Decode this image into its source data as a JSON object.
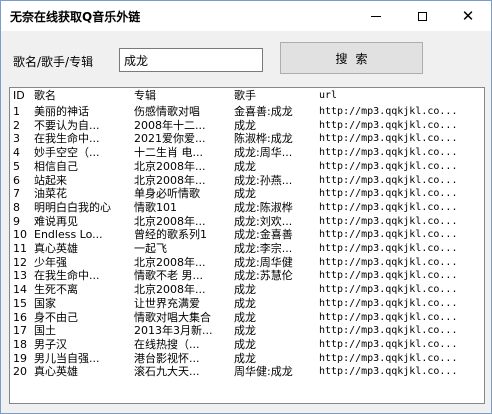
{
  "window": {
    "title": "无奈在线获取Q音乐外链",
    "min_label": "—",
    "max_label": "□",
    "close_label": "✕"
  },
  "search": {
    "label": "歌名/歌手/专辑",
    "value": "成龙",
    "button_label": "搜索"
  },
  "table": {
    "columns": [
      "ID",
      "歌名",
      "专辑",
      "歌手",
      "url"
    ],
    "rows": [
      [
        "1",
        "美丽的神话",
        "伤感情歌对唱",
        "金喜善:成龙",
        "http://mp3.qqkjkl.co..."
      ],
      [
        "2",
        "不要认为自...",
        "2008年十二...",
        "成龙",
        "http://mp3.qqkjkl.co..."
      ],
      [
        "3",
        "在我生命中...",
        "2021爱你爱...",
        "陈淑桦:成龙",
        "http://mp3.qqkjkl.co..."
      ],
      [
        "4",
        "妙手空空（...",
        "十二生肖 电...",
        "成龙:周华...",
        "http://mp3.qqkjkl.co..."
      ],
      [
        "5",
        "相信自己",
        "北京2008年...",
        "成龙",
        "http://mp3.qqkjkl.co..."
      ],
      [
        "6",
        "站起来",
        "北京2008年...",
        "成龙:孙燕...",
        "http://mp3.qqkjkl.co..."
      ],
      [
        "7",
        "油菜花",
        "单身必听情歌",
        "成龙",
        "http://mp3.qqkjkl.co..."
      ],
      [
        "8",
        "明明白白我的心",
        "情歌101",
        "成龙:陈淑桦",
        "http://mp3.qqkjkl.co..."
      ],
      [
        "9",
        "难说再见",
        "北京2008年...",
        "成龙:刘欢...",
        "http://mp3.qqkjkl.co..."
      ],
      [
        "10",
        "Endless  Lo...",
        "曾经的歌系列1",
        "成龙:金喜善",
        "http://mp3.qqkjkl.co..."
      ],
      [
        "11",
        "真心英雄",
        "一起飞",
        "成龙:李宗...",
        "http://mp3.qqkjkl.co..."
      ],
      [
        "12",
        "少年强",
        "北京2008年...",
        "成龙:周华健",
        "http://mp3.qqkjkl.co..."
      ],
      [
        "13",
        "在我生命中...",
        "情歌不老 男...",
        "成龙:苏慧伦",
        "http://mp3.qqkjkl.co..."
      ],
      [
        "14",
        "生死不离",
        "北京2008年...",
        "成龙",
        "http://mp3.qqkjkl.co..."
      ],
      [
        "15",
        "国家",
        "让世界充满爱",
        "成龙",
        "http://mp3.qqkjkl.co..."
      ],
      [
        "16",
        "身不由己",
        "情歌对唱大集合",
        "成龙",
        "http://mp3.qqkjkl.co..."
      ],
      [
        "17",
        "国土",
        "2013年3月新...",
        "成龙",
        "http://mp3.qqkjkl.co..."
      ],
      [
        "18",
        "男子汉",
        "在线热搜（...",
        "成龙",
        "http://mp3.qqkjkl.co..."
      ],
      [
        "19",
        "男儿当自强...",
        "港台影视怀...",
        "成龙",
        "http://mp3.qqkjkl.co..."
      ],
      [
        "20",
        "真心英雄",
        "滚石九大天...",
        "周华健:成龙",
        "http://mp3.qqkjkl.co..."
      ]
    ]
  }
}
